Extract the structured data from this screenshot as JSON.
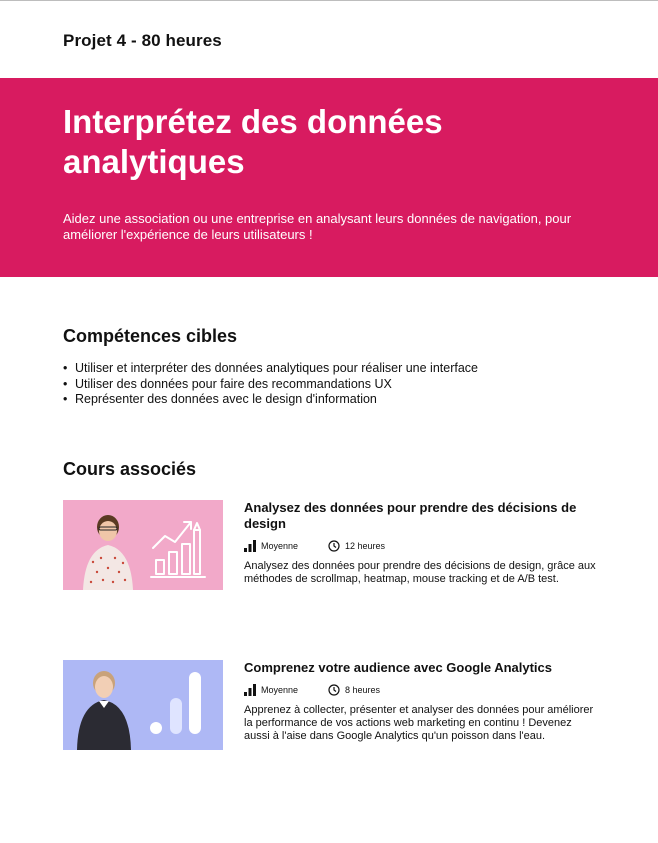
{
  "colors": {
    "accent": "#d81b60",
    "text": "#111111",
    "thumb1_bg": "#f2a9c9",
    "thumb2_bg": "#aeb8f5"
  },
  "project": {
    "label": "Projet 4 - 80 heures"
  },
  "hero": {
    "title": "Interprétez des données analytiques",
    "description": "Aidez une association ou une entreprise en analysant leurs données de navigation, pour améliorer l'expérience de leurs utilisateurs !"
  },
  "skills": {
    "heading": "Compétences cibles",
    "items": [
      "Utiliser et interpréter des données analytiques pour réaliser une interface",
      "Utiliser des données pour faire des recommandations UX",
      "Représenter des données avec le design d'information"
    ]
  },
  "courses": {
    "heading": "Cours associés",
    "items": [
      {
        "title": "Analysez des données pour prendre des décisions de design",
        "level": "Moyenne",
        "duration": "12 heures",
        "description": "Analysez des données pour prendre des décisions de design, grâce aux méthodes de scrollmap, heatmap, mouse tracking et de A/B test.",
        "thumbnail_icon": "chart-growth-icon"
      },
      {
        "title": "Comprenez votre audience avec Google Analytics",
        "level": "Moyenne",
        "duration": "8 heures",
        "description": "Apprenez à collecter, présenter et analyser des données pour améliorer la performance de vos actions web marketing en continu ! Devenez aussi à l'aise dans Google Analytics qu'un poisson dans l'eau.",
        "thumbnail_icon": "analytics-logo-icon"
      }
    ]
  }
}
